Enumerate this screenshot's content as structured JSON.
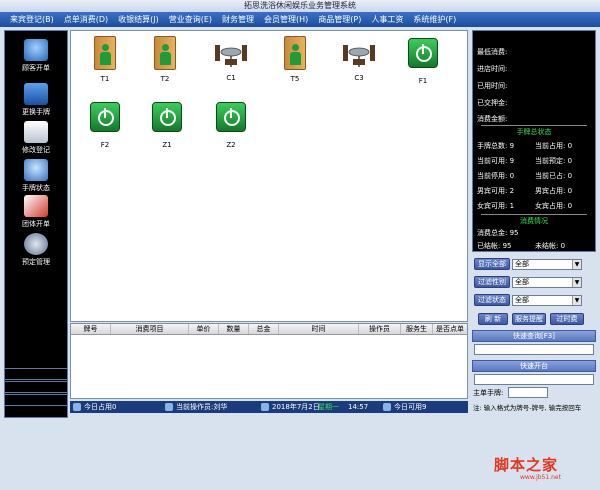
{
  "window": {
    "title": "拓思洗浴休闲娱乐业务管理系统"
  },
  "menu": [
    "来宾登记(B)",
    "点单消费(D)",
    "收银结算(J)",
    "营业查询(E)",
    "财务管理",
    "会员管理(H)",
    "商品管理(P)",
    "人事工资",
    "系统维护(F)"
  ],
  "sidebar": [
    {
      "label": "顾客开单",
      "icon": "guest-open-icon"
    },
    {
      "label": "更换手牌",
      "icon": "card-swap-icon"
    },
    {
      "label": "修改登记",
      "icon": "edit-register-icon"
    },
    {
      "label": "手牌状态",
      "icon": "card-status-icon"
    },
    {
      "label": "团体开单",
      "icon": "group-open-icon"
    },
    {
      "label": "预定管理",
      "icon": "reservation-icon"
    }
  ],
  "tiles": [
    {
      "label": "T1",
      "kind": "door"
    },
    {
      "label": "T2",
      "kind": "door"
    },
    {
      "label": "C1",
      "kind": "table"
    },
    {
      "label": "T5",
      "kind": "door"
    },
    {
      "label": "C3",
      "kind": "table"
    },
    {
      "label": "F1",
      "kind": "power"
    },
    {
      "label": "F2",
      "kind": "power"
    },
    {
      "label": "Z1",
      "kind": "power"
    },
    {
      "label": "Z2",
      "kind": "power"
    }
  ],
  "grid": {
    "columns": [
      "牌号",
      "消费项目",
      "单价",
      "数量",
      "总金",
      "时间",
      "操作员",
      "服务生",
      "是否点单"
    ]
  },
  "status": {
    "today_used": "今日占用0",
    "operator": "当前操作员:刘华",
    "date": "2018年7月2日",
    "weekday": "星期一",
    "time": "14:57",
    "today_available": "今日可用9"
  },
  "info": {
    "labels": [
      "最低消费:",
      "进店时间:",
      "已用时间:",
      "已交押金:",
      "消费金额:"
    ],
    "card_header": "手牌总状态",
    "card_rows": [
      [
        "手牌总数: 9",
        "当前占用: 0"
      ],
      [
        "当前可用: 9",
        "当前预定: 0"
      ],
      [
        "当前停用: 0",
        "当前已占: 0"
      ],
      [
        "男宾可用: 2",
        "男宾占用: 0"
      ],
      [
        "女宾可用: 1",
        "女宾占用: 0"
      ]
    ],
    "consume_header": "消费情况",
    "consume_total": "消费总金: 95",
    "consume_rows": [
      "已结帐: 95",
      "未结帐: 0"
    ]
  },
  "controls": {
    "show_all": "显示全部",
    "filter_gender": "过滤性别",
    "filter_status": "过滤状态",
    "all": "全部",
    "refresh": "刷 新",
    "service_reminder": "服务提醒",
    "overtime": "过时费",
    "quick_query": "快速查询[F3]",
    "quick_open": "快速开台",
    "main_card_label": "主单手牌:",
    "hint": "注: 输入格式为牌号-牌号, 输完按回车"
  },
  "watermark": {
    "text": "脚本之家",
    "url": "www.jb51.net"
  }
}
